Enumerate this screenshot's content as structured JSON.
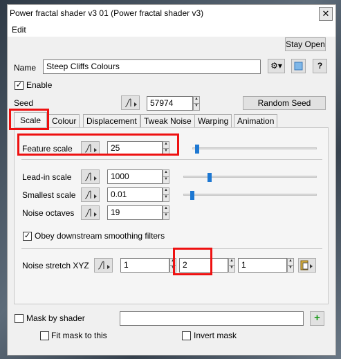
{
  "window": {
    "title": "Power fractal shader v3 01    (Power fractal shader v3)",
    "close": "✕"
  },
  "menu": {
    "edit": "Edit"
  },
  "toolbar": {
    "stay_open": "Stay Open"
  },
  "name": {
    "label": "Name",
    "value": "Steep Cliffs Colours"
  },
  "enable": {
    "label": "Enable",
    "checked": true
  },
  "seed": {
    "label": "Seed",
    "value": "57974",
    "random_button": "Random Seed"
  },
  "tabs": [
    "Scale",
    "Colour",
    "Displacement",
    "Tweak Noise",
    "Warping",
    "Animation"
  ],
  "scale_tab": {
    "feature_scale": {
      "label": "Feature scale",
      "value": "25",
      "slider": 0.02
    },
    "lead_in_scale": {
      "label": "Lead-in scale",
      "value": "1000",
      "slider": 0.18
    },
    "smallest_scale": {
      "label": "Smallest scale",
      "value": "0.01",
      "slider": 0.05
    },
    "noise_octaves": {
      "label": "Noise octaves",
      "value": "19"
    },
    "obey_smoothing": {
      "label": "Obey downstream smoothing filters",
      "checked": true
    },
    "noise_stretch": {
      "label": "Noise stretch XYZ",
      "x": "1",
      "y": "2",
      "z": "1"
    }
  },
  "mask": {
    "label": "Mask by shader",
    "value": "",
    "fit_label": "Fit mask to this",
    "invert_label": "Invert mask"
  },
  "colors": {
    "accent": "#1e78d2",
    "highlight": "#ee1111"
  }
}
